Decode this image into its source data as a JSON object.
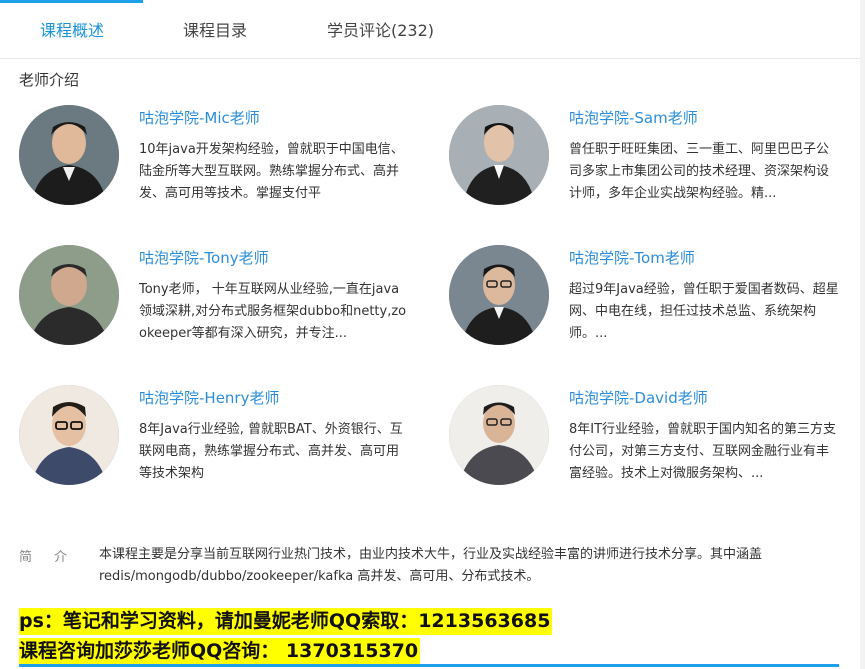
{
  "tabs": [
    {
      "label": "课程概述",
      "active": true
    },
    {
      "label": "课程目录",
      "active": false
    },
    {
      "label": "学员评论(232)",
      "active": false
    }
  ],
  "section_title": "老师介绍",
  "teachers": [
    {
      "name": "咕泡学院-Mic老师",
      "desc": "10年java开发架构经验，曾就职于中国电信、陆金所等大型互联网。熟练掌握分布式、高并发、高可用等技术。掌握支付平"
    },
    {
      "name": "咕泡学院-Sam老师",
      "desc": "曾任职于旺旺集团、三一重工、阿里巴巴子公司多家上市集团公司的技术经理、资深架构设计师，多年企业实战架构经验。精..."
    },
    {
      "name": "咕泡学院-Tony老师",
      "desc": "Tony老师， 十年互联网从业经验,一直在java领域深耕,对分布式服务框架dubbo和netty,zookeeper等都有深入研究，并专注..."
    },
    {
      "name": "咕泡学院-Tom老师",
      "desc": "超过9年Java经验，曾任职于爱国者数码、超星网、中电在线，担任过技术总监、系统架构师。..."
    },
    {
      "name": "咕泡学院-Henry老师",
      "desc": "8年Java行业经验, 曾就职BAT、外资银行、互联网电商，熟练掌握分布式、高并发、高可用等技术架构"
    },
    {
      "name": "咕泡学院-David老师",
      "desc": "8年IT行业经验，曾就职于国内知名的第三方支付公司，对第三方支付、互联网金融行业有丰富经验。技术上对微服务架构、..."
    }
  ],
  "intro": {
    "label": "简介",
    "text": "本课程主要是分享当前互联网行业热门技术，由业内技术大牛，行业及实战经验丰富的讲师进行技术分享。其中涵盖redis/mongodb/dubbo/zookeeper/kafka 高并发、高可用、分布式技术。"
  },
  "highlights": [
    "ps：笔记和学习资料，请加曼妮老师QQ索取：1213563685",
    "课程咨询加莎莎老师QQ咨询： 1370315370"
  ],
  "colors": {
    "accent": "#1da0e9",
    "link": "#2c8ed8",
    "highlight_bg": "#ffff00"
  }
}
